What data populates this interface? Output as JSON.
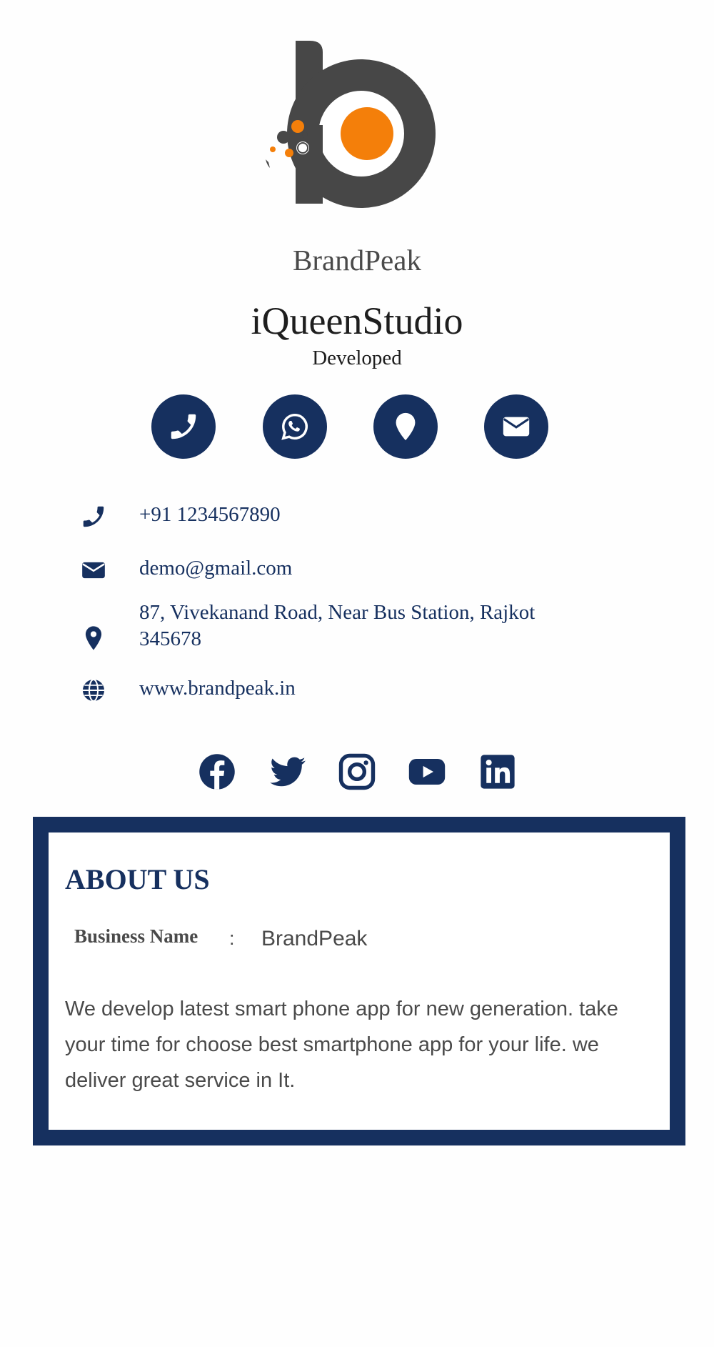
{
  "header": {
    "brand_name": "BrandPeak",
    "studio_name": "iQueenStudio",
    "subtitle": "Developed"
  },
  "colors": {
    "primary": "#16305f",
    "logo_dark": "#474747",
    "logo_accent": "#f47f0a"
  },
  "action_buttons": [
    {
      "icon": "phone-icon"
    },
    {
      "icon": "whatsapp-icon"
    },
    {
      "icon": "location-icon"
    },
    {
      "icon": "email-icon"
    }
  ],
  "contacts": {
    "phone": "+91 1234567890",
    "email": "demo@gmail.com",
    "address_line1": "87, Vivekanand Road, Near Bus Station, Rajkot",
    "address_line2": "345678",
    "website": "www.brandpeak.in"
  },
  "social": [
    "facebook-icon",
    "twitter-icon",
    "instagram-icon",
    "youtube-icon",
    "linkedin-icon"
  ],
  "about": {
    "title": "ABOUT US",
    "business_name_label": "Business Name",
    "separator": ":",
    "business_name_value": "BrandPeak",
    "description": "We develop latest smart phone app for new generation. take your time for choose best smartphone app for your life. we deliver great service in It."
  }
}
